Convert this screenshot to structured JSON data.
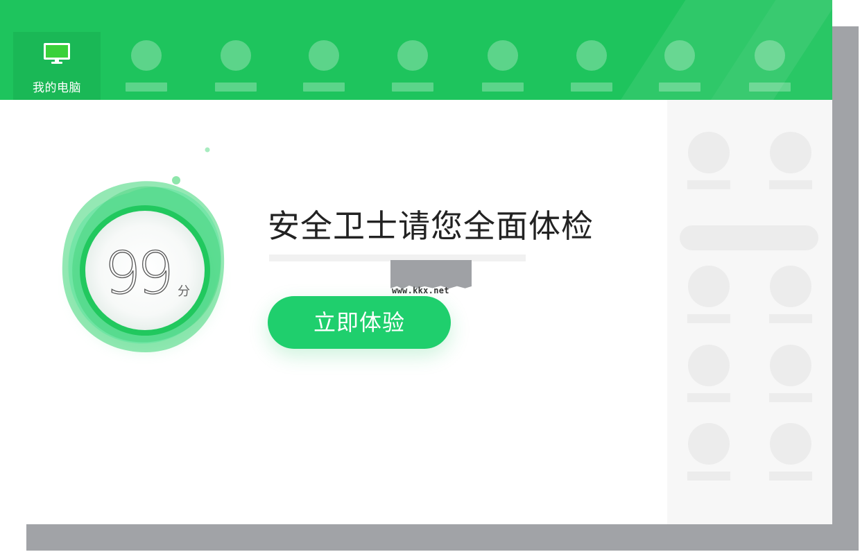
{
  "topbar": {
    "active_tab": {
      "label": "我的电脑",
      "icon": "monitor-icon"
    },
    "placeholder_tab_count": 8,
    "colors": {
      "background": "#1ec45d",
      "active_tab": "#1ab856"
    }
  },
  "main": {
    "score": {
      "value": "99",
      "unit": "分"
    },
    "headline": "安全卫士请您全面体检",
    "cta_label": "立即体验",
    "watermark": "www.kkx.net"
  },
  "colors": {
    "accent": "#1fcf6d",
    "placeholder": "#ececec",
    "panel_bg": "#f7f7f7"
  }
}
